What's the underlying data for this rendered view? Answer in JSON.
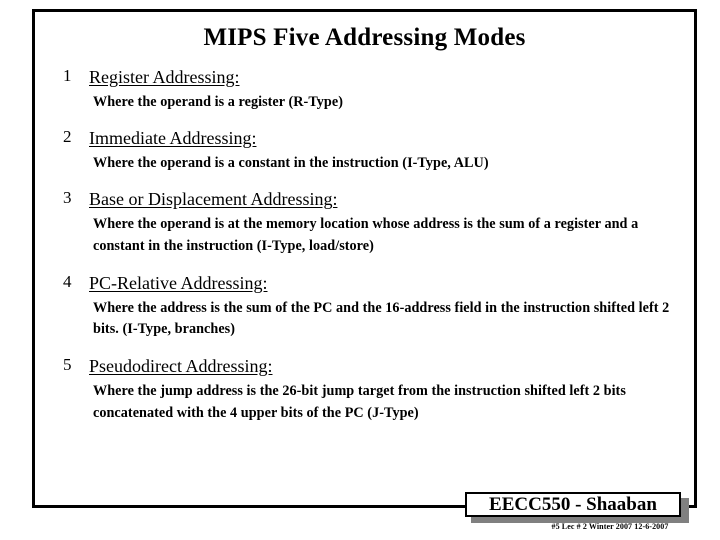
{
  "slide": {
    "title": "MIPS Five Addressing Modes",
    "modes": [
      {
        "number": "1",
        "title": "Register Addressing:",
        "description": "Where the operand is a register (R-Type)"
      },
      {
        "number": "2",
        "title": "Immediate Addressing:",
        "description": "Where the operand is a constant in the instruction (I-Type, ALU)"
      },
      {
        "number": "3",
        "title": "Base or Displacement Addressing:",
        "description": "Where the operand is at the memory location whose address is the sum of a register and a constant in the instruction (I-Type, load/store)"
      },
      {
        "number": "4",
        "title": "PC-Relative Addressing:",
        "description": "Where the address is the sum of the PC and the 16-address field in the instruction shifted left 2 bits.  (I-Type, branches)"
      },
      {
        "number": "5",
        "title": "Pseudodirect Addressing:",
        "description": "Where the jump address is the 26-bit  jump target from the instruction shifted left 2 bits concatenated with the 4 upper bits of the PC  (J-Type)"
      }
    ]
  },
  "footer": {
    "badge_label": "EECC550 - Shaaban",
    "sub_label": "#5  Lec # 2  Winter 2007  12-6-2007",
    "badge_shadow_color": "#808080",
    "badge_border_color": "#000000"
  }
}
